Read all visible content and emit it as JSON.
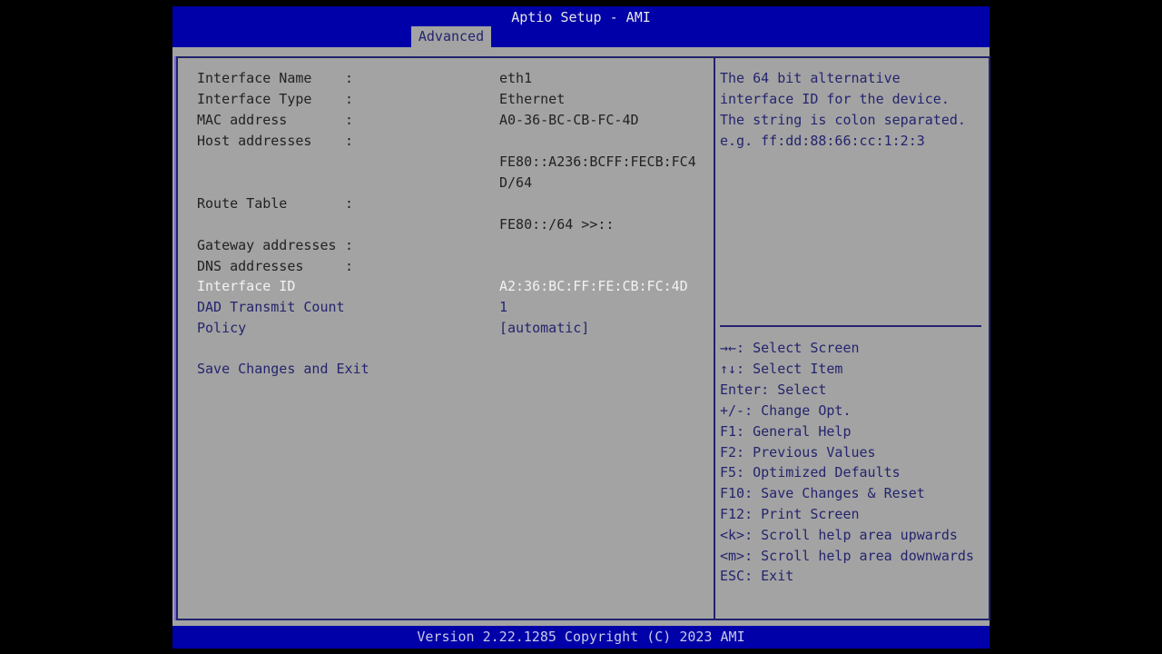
{
  "header": {
    "title": "Aptio Setup - AMI",
    "active_tab": "Advanced"
  },
  "main": {
    "info_rows": [
      {
        "label": "Interface Name",
        "colon": ":",
        "value": "eth1"
      },
      {
        "label": "Interface Type",
        "colon": ":",
        "value": "Ethernet"
      },
      {
        "label": "MAC address",
        "colon": ":",
        "value": "A0-36-BC-CB-FC-4D"
      },
      {
        "label": "Host addresses",
        "colon": ":",
        "value": ""
      },
      {
        "value_line1": "FE80::A236:BCFF:FECB:FC4",
        "value_line2": "D/64"
      },
      {
        "label": "Route Table",
        "colon": ":",
        "value": ""
      },
      {
        "value": "FE80::/64 >>::"
      },
      {
        "label": "Gateway addresses",
        "colon": ":"
      },
      {
        "label": "DNS addresses",
        "colon": ":"
      }
    ],
    "settings": [
      {
        "label": "Interface ID",
        "value": "A2:36:BC:FF:FE:CB:FC:4D",
        "selected": true
      },
      {
        "label": "DAD Transmit Count",
        "value": "1"
      },
      {
        "label": "Policy",
        "value": "[automatic]"
      }
    ],
    "save_exit": "Save Changes and Exit"
  },
  "help": {
    "description": [
      "The 64 bit alternative",
      "interface ID for the device.",
      "The string is colon separated.",
      "e.g. ff:dd:88:66:cc:1:2:3"
    ],
    "keys": [
      "→←: Select Screen",
      "↑↓: Select Item",
      "Enter: Select",
      "+/-: Change Opt.",
      "F1: General Help",
      "F2: Previous Values",
      "F5: Optimized Defaults",
      "F10: Save Changes & Reset",
      "F12: Print Screen",
      "<k>: Scroll help area upwards",
      "<m>: Scroll help area downwards",
      "ESC: Exit"
    ]
  },
  "footer": {
    "version": "Version 2.22.1285 Copyright (C) 2023 AMI"
  }
}
